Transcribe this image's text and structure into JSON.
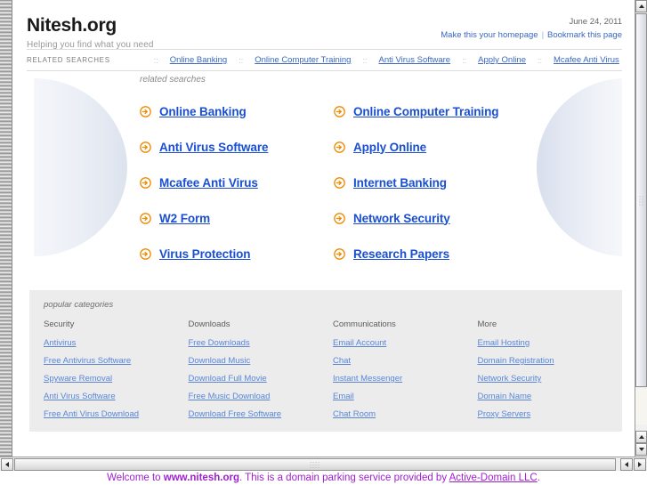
{
  "header": {
    "title": "Nitesh.org",
    "tagline": "Helping you find what you need",
    "date": "June 24, 2011",
    "homepage_link": "Make this your homepage",
    "bookmark_link": "Bookmark this page",
    "link_separator": "|"
  },
  "related_bar": {
    "label": "RELATED SEARCHES",
    "separator": "::",
    "items": [
      {
        "label": "Online Banking"
      },
      {
        "label": "Online Computer Training"
      },
      {
        "label": "Anti Virus Software"
      },
      {
        "label": "Apply Online"
      },
      {
        "label": "Mcafee Anti Virus"
      }
    ]
  },
  "hero": {
    "caption": "related searches",
    "icon": "arrow-circle-right-icon",
    "left_column": [
      {
        "label": "Online Banking"
      },
      {
        "label": "Anti Virus Software"
      },
      {
        "label": "Mcafee Anti Virus"
      },
      {
        "label": "W2 Form"
      },
      {
        "label": "Virus Protection"
      }
    ],
    "right_column": [
      {
        "label": "Online Computer Training"
      },
      {
        "label": "Apply Online"
      },
      {
        "label": "Internet Banking"
      },
      {
        "label": "Network Security"
      },
      {
        "label": "Research Papers"
      }
    ]
  },
  "categories": {
    "caption": "popular categories",
    "columns": [
      {
        "heading": "Security",
        "links": [
          "Antivirus",
          "Free Antivirus Software",
          "Spyware Removal",
          "Anti Virus Software",
          "Free Anti Virus Download"
        ]
      },
      {
        "heading": "Downloads",
        "links": [
          "Free Downloads",
          "Download Music",
          "Download Full Movie",
          "Free Music Download",
          "Download Free Software"
        ]
      },
      {
        "heading": "Communications",
        "links": [
          "Email Account",
          "Chat",
          "Instant Messenger",
          "Email",
          "Chat Room"
        ]
      },
      {
        "heading": "More",
        "links": [
          "Email Hosting",
          "Domain Registration",
          "Network Security",
          "Domain Name",
          "Proxy Servers"
        ]
      }
    ]
  },
  "footer": {
    "prefix": "Welcome to ",
    "domain": "www.nitesh.org",
    "middle": ". This is a domain parking service provided by ",
    "provider_link": "Active-Domain LLC",
    "suffix": "."
  },
  "scrollbars": {
    "vertical_up_icon": "triangle-up-icon",
    "vertical_down_icon": "triangle-down-icon",
    "horizontal_left_icon": "triangle-left-icon",
    "horizontal_right_icon": "triangle-right-icon"
  },
  "colors": {
    "link_blue": "#3a67c0",
    "hero_link_blue": "#1a4fd0",
    "category_link_blue": "#5a86d8",
    "arrow_orange": "#f08a00",
    "footer_purple": "#a020d0",
    "category_bg": "#ececec"
  }
}
